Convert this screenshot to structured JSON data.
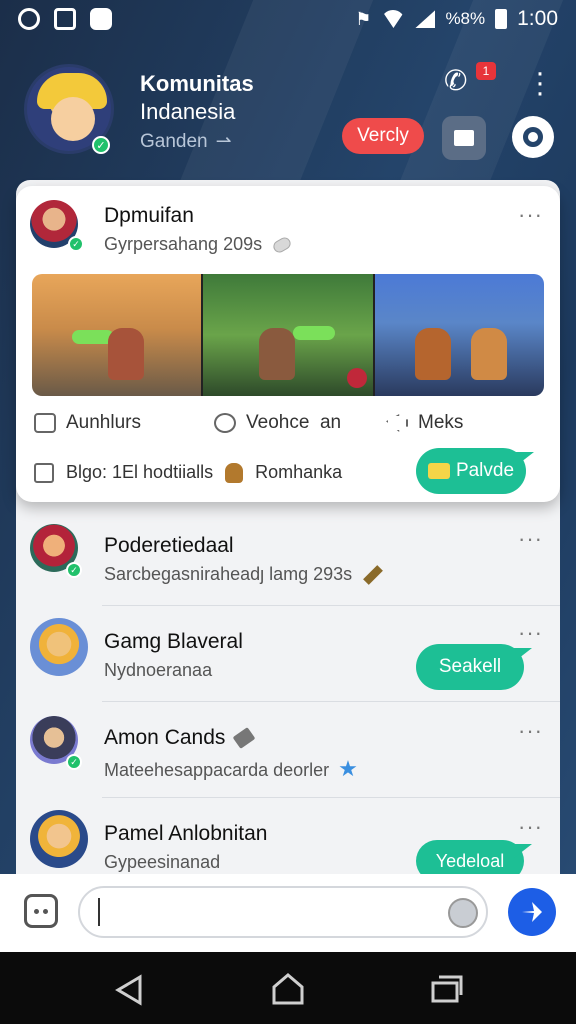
{
  "status_bar": {
    "time": "1:00",
    "battery_text": "%8%",
    "icons": [
      "clock-icon",
      "square-app-icon",
      "hexagon-app-icon",
      "accessibility-icon",
      "wifi-icon",
      "signal-icon",
      "battery-icon"
    ]
  },
  "header": {
    "title_line1": "Komunitas",
    "title_line2": "Indanesia",
    "subtitle": "Ganden",
    "subtitle_arrow": "⇀",
    "call_badge": "1",
    "verify_label": "Vercly"
  },
  "featured_post": {
    "name": "Dpmuifan",
    "snippet": "Gyrpersahang 209s",
    "actions": [
      {
        "label": "Aunhlurs",
        "icon": "comment-box-icon"
      },
      {
        "label": "Veohce  an",
        "icon": "chat-bubble-icon"
      },
      {
        "label": "Meks",
        "icon": "share-icon"
      }
    ],
    "meta_text": "Blgo: 1El hodtiialls",
    "meta_user": "Romhanka",
    "pill_label": "Palvde"
  },
  "conversations": [
    {
      "name": "Poderetiedaal",
      "snippet": "Sarcbegasniraheadȷ lamg 293s",
      "pill_label": ""
    },
    {
      "name": "Gamg Blaveral",
      "snippet": "Nydnoeranaa",
      "pill_label": "Seakell"
    },
    {
      "name": "Amon Cands",
      "snippet": "Mateehesappacarda deorler",
      "pill_label": ""
    },
    {
      "name": "Pamel Anlobnitan",
      "snippet": "Gypeesinanad",
      "pill_label": "Yedeloal"
    }
  ],
  "compose": {
    "placeholder": ""
  },
  "colors": {
    "header_bg": "#1f3552",
    "accent_red": "#ef4b4b",
    "accent_teal": "#1dbf95",
    "send_blue": "#1d5ee6",
    "online_green": "#21c16b"
  }
}
